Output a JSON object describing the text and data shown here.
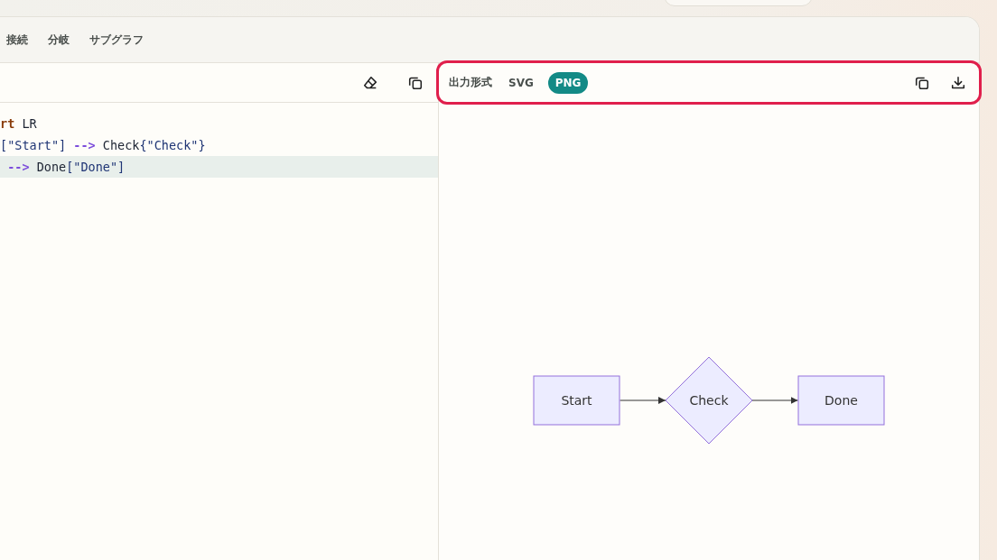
{
  "tabs": [
    {
      "label": "接続"
    },
    {
      "label": "分岐"
    },
    {
      "label": "サブグラフ"
    }
  ],
  "editor": {
    "lines": [
      {
        "active": false,
        "tokens": [
          {
            "text": "rt",
            "kind": "keyword"
          },
          {
            "text": " LR",
            "kind": "plain"
          }
        ]
      },
      {
        "active": false,
        "tokens": [
          {
            "text": "[\"Start\"]",
            "kind": "string"
          },
          {
            "text": " -->",
            "kind": "arrow"
          },
          {
            "text": " Check",
            "kind": "plain"
          },
          {
            "text": "{\"Check\"}",
            "kind": "string"
          }
        ]
      },
      {
        "active": true,
        "tokens": [
          {
            "text": " -->",
            "kind": "arrow"
          },
          {
            "text": " Done",
            "kind": "plain"
          },
          {
            "text": "[\"Done\"]",
            "kind": "string"
          }
        ]
      }
    ]
  },
  "output": {
    "label": "出力形式",
    "formats": [
      {
        "label": "SVG",
        "selected": false
      },
      {
        "label": "PNG",
        "selected": true
      }
    ]
  },
  "diagram": {
    "nodes": [
      {
        "label": "Start",
        "kind": "box"
      },
      {
        "label": "Check",
        "kind": "diamond"
      },
      {
        "label": "Done",
        "kind": "box"
      }
    ]
  }
}
